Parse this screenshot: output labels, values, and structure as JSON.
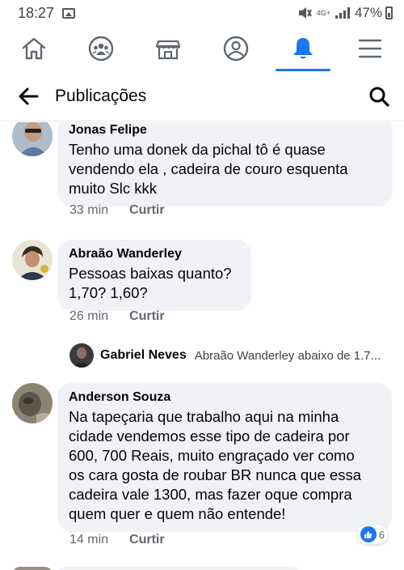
{
  "status_bar": {
    "time": "18:27",
    "network": "4G+",
    "battery": "47%"
  },
  "nav": {
    "tabs": [
      {
        "name": "home",
        "icon": "home-icon",
        "active": false
      },
      {
        "name": "groups",
        "icon": "groups-icon",
        "active": false
      },
      {
        "name": "marketplace",
        "icon": "marketplace-icon",
        "active": false
      },
      {
        "name": "profile",
        "icon": "profile-icon",
        "active": false
      },
      {
        "name": "notifications",
        "icon": "bell-icon",
        "active": true
      },
      {
        "name": "menu",
        "icon": "menu-icon",
        "active": false
      }
    ],
    "accent_color": "#1877f2"
  },
  "header": {
    "title": "Publicações",
    "back_icon": "arrow-left-icon",
    "search_icon": "search-icon"
  },
  "comments": [
    {
      "author": "Jonas Felipe",
      "lines": [
        "Tenho uma donek  da pichal  tô é quase",
        "vendendo ela , cadeira de couro esquenta",
        "muito Slc kkk"
      ],
      "time": "33 min",
      "like_label": "Curtir"
    },
    {
      "author": "Abraão Wanderley",
      "lines": [
        "Pessoas baixas quanto?",
        "1,70? 1,60?"
      ],
      "time": "26 min",
      "like_label": "Curtir"
    },
    {
      "author": "Anderson Souza",
      "lines": [
        "Na tapeçaria que trabalho aqui na minha",
        "cidade vendemos esse tipo de cadeira por",
        "600, 700 Reais, muito engraçado ver como",
        "os cara gosta de roubar BR nunca que essa",
        "cadeira vale 1300, mas fazer oque compra",
        "quem quer e quem não entende!"
      ],
      "time": "14 min",
      "like_label": "Curtir",
      "reaction_count": "6"
    }
  ],
  "reply_preview": {
    "author": "Gabriel Neves",
    "text": "Abraão Wanderley abaixo de 1.7..."
  }
}
